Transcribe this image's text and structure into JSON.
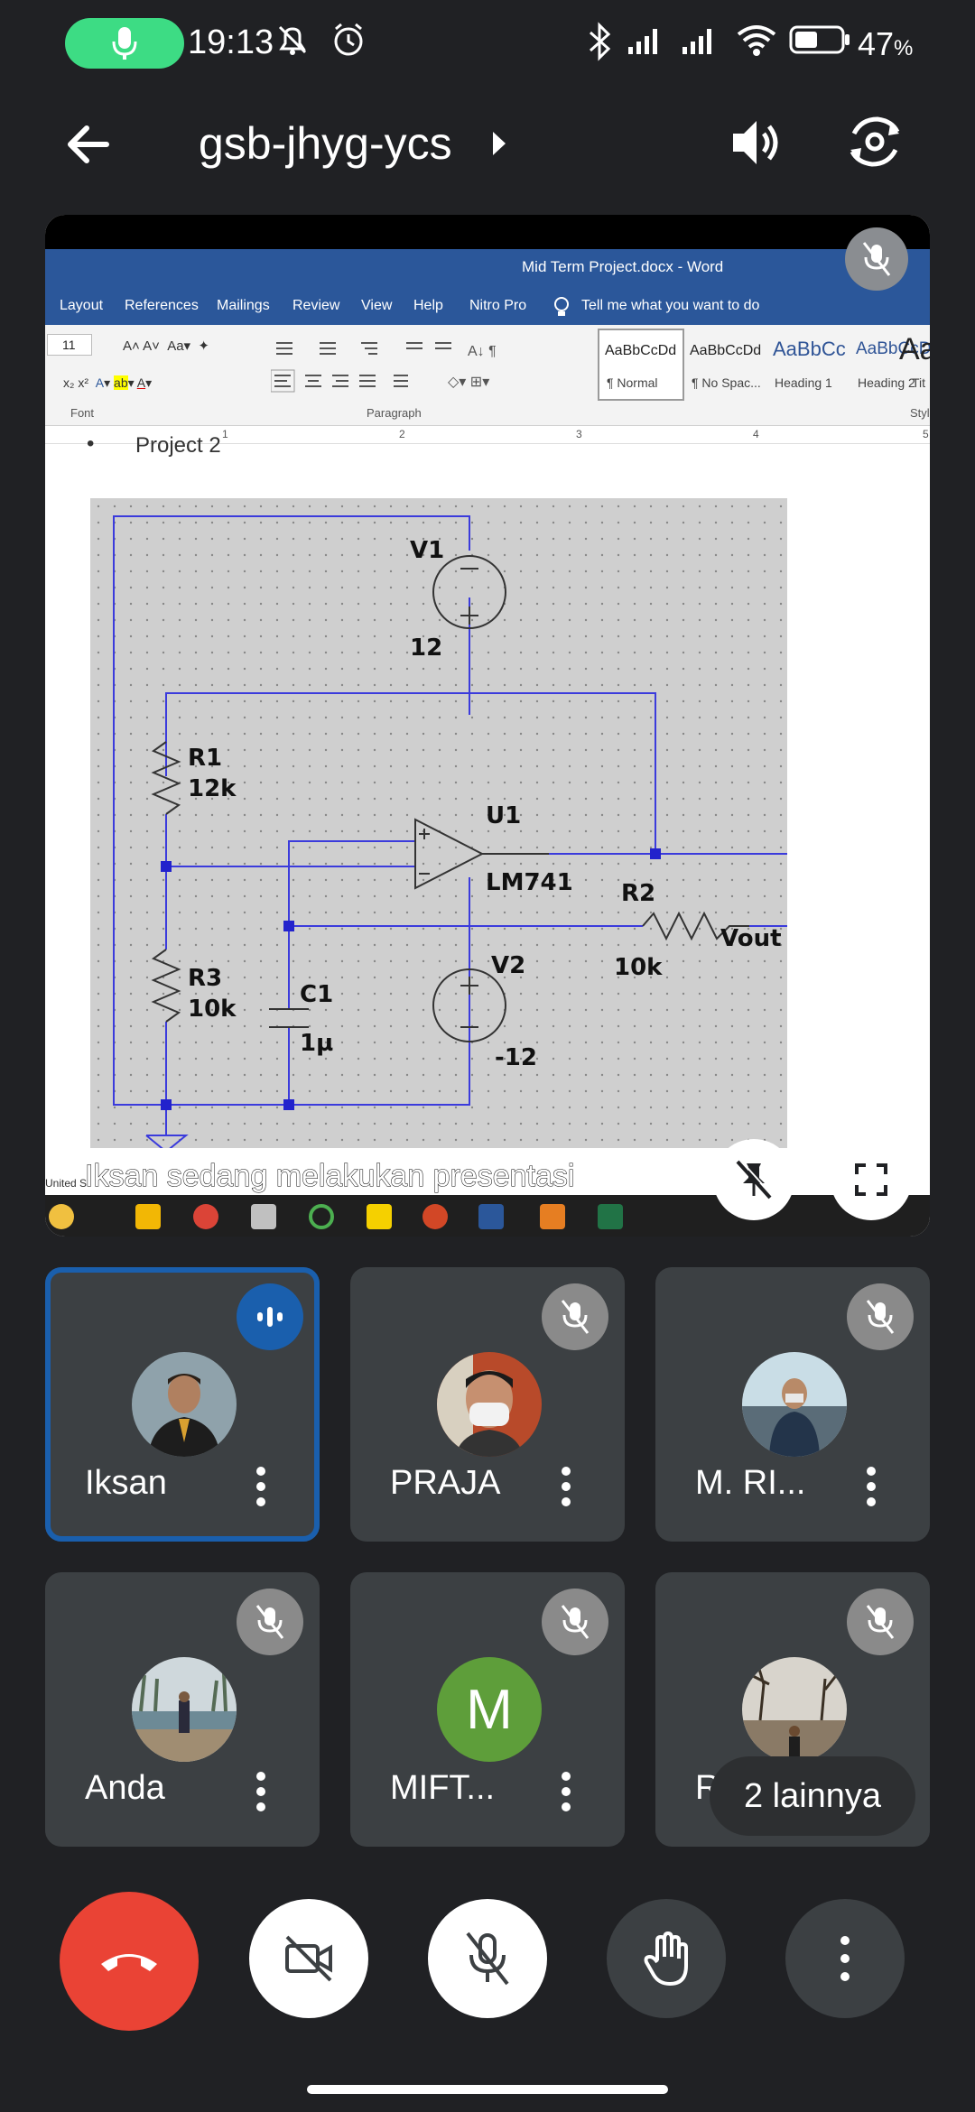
{
  "status_bar": {
    "time": "19:13",
    "battery": "47",
    "battery_unit": "%"
  },
  "meeting": {
    "code": "gsb-jhyg-ycs"
  },
  "presentation": {
    "caption": "Iksan sedang melakukan presentasi",
    "word_title": "Mid Term Project.docx  -  Word",
    "tabs": [
      "Layout",
      "References",
      "Mailings",
      "Review",
      "View",
      "Help",
      "Nitro Pro"
    ],
    "tell_me": "Tell me what you want to do",
    "font_size": "11",
    "groups": {
      "font": "Font",
      "paragraph": "Paragraph",
      "styles": "Styl"
    },
    "styles": [
      {
        "preview": "AaBbCcDd",
        "name": "¶ Normal"
      },
      {
        "preview": "AaBbCcDd",
        "name": "¶ No Spac..."
      },
      {
        "preview": "AaBbCc",
        "name": "Heading 1"
      },
      {
        "preview": "AaBbCcD",
        "name": "Heading 2"
      },
      {
        "preview": "Aa",
        "name": "Tit"
      }
    ],
    "ruler_marks": [
      "1",
      "2",
      "3",
      "4",
      "5"
    ],
    "doc_heading": "Project 2",
    "status_text": "United S",
    "circuit": {
      "v1_name": "V1",
      "v1_value": "12",
      "r1_name": "R1",
      "r1_value": "12k",
      "u1_name": "U1",
      "u1_model": "LM741",
      "r2_name": "R2",
      "r2_value": "10k",
      "vout": "Vout",
      "v2_name": "V2",
      "v2_value": "-12",
      "r3_name": "R3",
      "r3_value": "10k",
      "c1_name": "C1",
      "c1_value": "1µ"
    }
  },
  "participants": [
    {
      "name": "Iksan",
      "speaking": true
    },
    {
      "name": "PRAJA",
      "muted": true
    },
    {
      "name": "M. RI...",
      "muted": true
    },
    {
      "name": "Anda",
      "muted": true
    },
    {
      "name": "MIFT...",
      "muted": true,
      "initial": "M",
      "avatar_color": "#5e9e3a"
    },
    {
      "name": "Rafi ...",
      "muted": true
    }
  ],
  "others_label": "2 lainnya",
  "colors": {
    "end_call": "#ea4335",
    "speaking_outline": "#1a5fad",
    "word_blue": "#2b579a"
  }
}
